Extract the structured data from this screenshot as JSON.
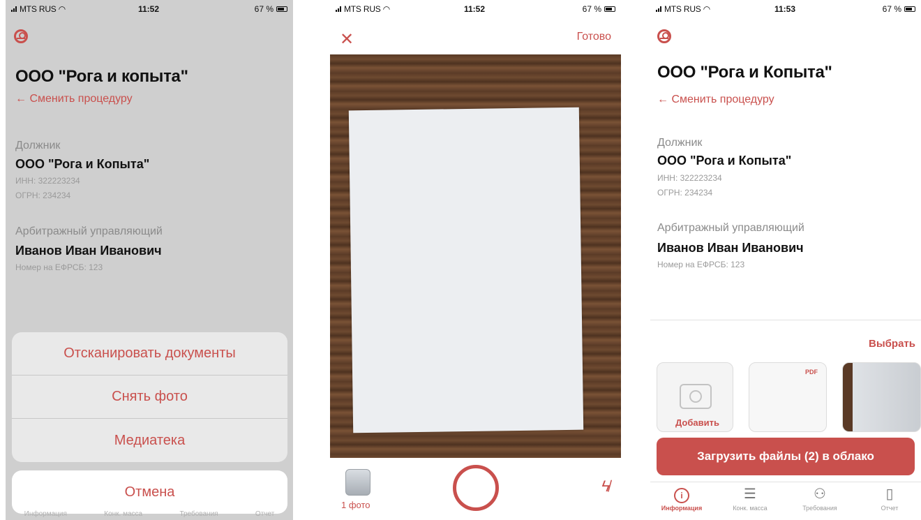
{
  "status_bars": [
    {
      "carrier": "MTS RUS",
      "time": "11:52",
      "battery": "67 %"
    },
    {
      "carrier": "MTS RUS",
      "time": "11:52",
      "battery": "67 %"
    },
    {
      "carrier": "MTS RUS",
      "time": "11:53",
      "battery": "67 %"
    }
  ],
  "screen1": {
    "title": "ООО \"Рога и копыта\"",
    "change_link": "← Сменить процедуру",
    "debtor_caption": "Должник",
    "debtor_name": "ООО \"Рога и Копыта\"",
    "inn": "ИНН: 322223234",
    "ogrn": "ОГРН: 234234",
    "manager_caption": "Арбитражный управляющий",
    "manager_name": "Иванов Иван Иванович",
    "efrsb": "Номер на ЕФРСБ: 123",
    "sheet": [
      "Отсканировать документы",
      "Снять фото",
      "Медиатека"
    ],
    "cancel": "Отмена",
    "tabs": [
      "Информация",
      "Конк. масса",
      "Требования",
      "Отчет"
    ]
  },
  "screen2": {
    "close": "✕",
    "done": "Готово",
    "photo_count": "1 фото"
  },
  "screen3": {
    "title": "ООО \"Рога и Копыта\"",
    "change_link": "← Сменить процедуру",
    "debtor_caption": "Должник",
    "debtor_name": "ООО \"Рога и Копыта\"",
    "inn": "ИНН: 322223234",
    "ogrn": "ОГРН: 234234",
    "manager_caption": "Арбитражный управляющий",
    "manager_name": "Иванов Иван Иванович",
    "efrsb": "Номер на ЕФРСБ: 123",
    "choose": "Выбрать",
    "add_label": "Добавить",
    "pdf_badge": "PDF",
    "upload": "Загрузить файлы (2) в облако",
    "tabs": [
      "Информация",
      "Конк. масса",
      "Требования",
      "Отчет"
    ]
  },
  "colors": {
    "accent": "#c9504d"
  }
}
